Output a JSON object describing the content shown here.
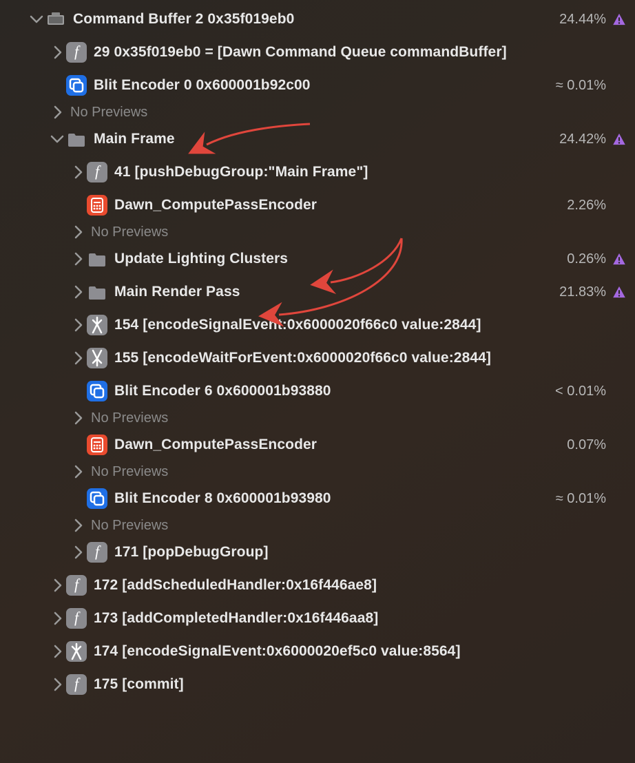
{
  "no_previews_label": "No Previews",
  "rows": [
    {
      "indent": 0,
      "disc": "down",
      "icon": "box",
      "label": "Command Buffer 2 0x35f019eb0",
      "pct": "24.44%",
      "warn": true
    },
    {
      "indent": 1,
      "disc": "right",
      "icon": "fn",
      "label": "29 0x35f019eb0 = [Dawn Command Queue commandBuffer]"
    },
    {
      "indent": 1,
      "disc": "right-low",
      "icon": "blit",
      "label": "Blit Encoder 0 0x600001b92c00",
      "pct": "≈ 0.01%",
      "noprev": true
    },
    {
      "indent": 1,
      "disc": "down",
      "icon": "folder",
      "label": "Main Frame",
      "pct": "24.42%",
      "warn": true
    },
    {
      "indent": 2,
      "disc": "right",
      "icon": "fn",
      "label": "41 [pushDebugGroup:\"Main Frame\"]"
    },
    {
      "indent": 2,
      "disc": "right-low",
      "icon": "compute",
      "label": "Dawn_ComputePassEncoder",
      "pct": "2.26%",
      "noprev": true
    },
    {
      "indent": 2,
      "disc": "right",
      "icon": "folder",
      "label": "Update Lighting Clusters",
      "pct": "0.26%",
      "warn": true
    },
    {
      "indent": 2,
      "disc": "right",
      "icon": "folder",
      "label": "Main Render Pass",
      "pct": "21.83%",
      "warn": true
    },
    {
      "indent": 2,
      "disc": "right",
      "icon": "signal",
      "label": "154 [encodeSignalEvent:0x6000020f66c0 value:2844]"
    },
    {
      "indent": 2,
      "disc": "right",
      "icon": "wait",
      "label": "155 [encodeWaitForEvent:0x6000020f66c0 value:2844]"
    },
    {
      "indent": 2,
      "disc": "right-low",
      "icon": "blit",
      "label": "Blit Encoder 6 0x600001b93880",
      "pct": "< 0.01%",
      "noprev": true
    },
    {
      "indent": 2,
      "disc": "right-low",
      "icon": "compute",
      "label": "Dawn_ComputePassEncoder",
      "pct": "0.07%",
      "noprev": true
    },
    {
      "indent": 2,
      "disc": "right-low",
      "icon": "blit",
      "label": "Blit Encoder 8 0x600001b93980",
      "pct": "≈ 0.01%",
      "noprev": true
    },
    {
      "indent": 2,
      "disc": "right",
      "icon": "fn",
      "label": "171 [popDebugGroup]"
    },
    {
      "indent": 1,
      "disc": "right",
      "icon": "fn",
      "label": "172 [addScheduledHandler:0x16f446ae8]"
    },
    {
      "indent": 1,
      "disc": "right",
      "icon": "fn",
      "label": "173 [addCompletedHandler:0x16f446aa8]"
    },
    {
      "indent": 1,
      "disc": "right",
      "icon": "signal",
      "label": "174 [encodeSignalEvent:0x6000020ef5c0 value:8564]"
    },
    {
      "indent": 1,
      "disc": "right",
      "icon": "fn",
      "label": "175 [commit]"
    }
  ]
}
